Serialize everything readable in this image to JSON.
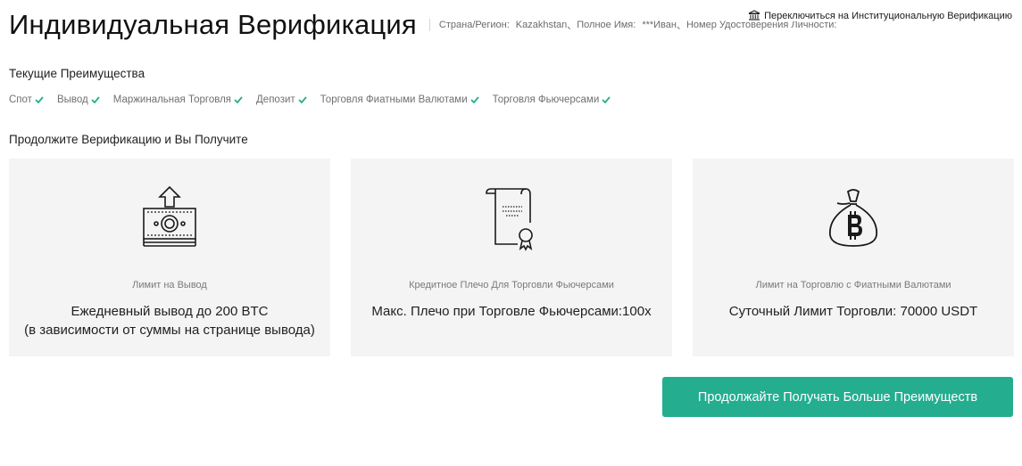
{
  "header": {
    "title": "Индивидуальная Верификация",
    "meta": {
      "country_label": "Страна/Регион:",
      "country_value": "Kazakhstan",
      "name_label": "Полное Имя:",
      "name_value": "***Иван",
      "id_label": "Номер Удостоверения Личности:",
      "separator": "、"
    },
    "switch_label": "Переключиться на Институциональную Верификацию",
    "switch_icon": "bank-icon"
  },
  "current_benefits": {
    "title": "Текущие Преимущества",
    "check_color": "#24ae8f",
    "items": [
      {
        "label": "Спот"
      },
      {
        "label": "Вывод"
      },
      {
        "label": "Маржинальная Торговля"
      },
      {
        "label": "Депозит"
      },
      {
        "label": "Торговля Фиатными Валютами"
      },
      {
        "label": "Торговля Фьючерсами"
      }
    ]
  },
  "continue": {
    "title": "Продолжите Верификацию и Вы Получите",
    "cards": [
      {
        "icon": "cash-upload-icon",
        "label": "Лимит на Вывод",
        "value_line1": "Ежедневный вывод до 200 BTC",
        "value_line2": "(в зависимости от суммы на странице вывода)"
      },
      {
        "icon": "certificate-icon",
        "label": "Кредитное Плечо Для Торговли Фьючерсами",
        "value_line1": "Макс. Плечо при Торговле Фьючерсами:100x",
        "value_line2": ""
      },
      {
        "icon": "bitcoin-bag-icon",
        "label": "Лимит на Торговлю с Фиатными Валютами",
        "value_line1": "Суточный Лимит Торговли: 70000 USDT",
        "value_line2": ""
      }
    ]
  },
  "cta": {
    "label": "Продолжайте Получать Больше Преимуществ",
    "color": "#24ae8f"
  }
}
